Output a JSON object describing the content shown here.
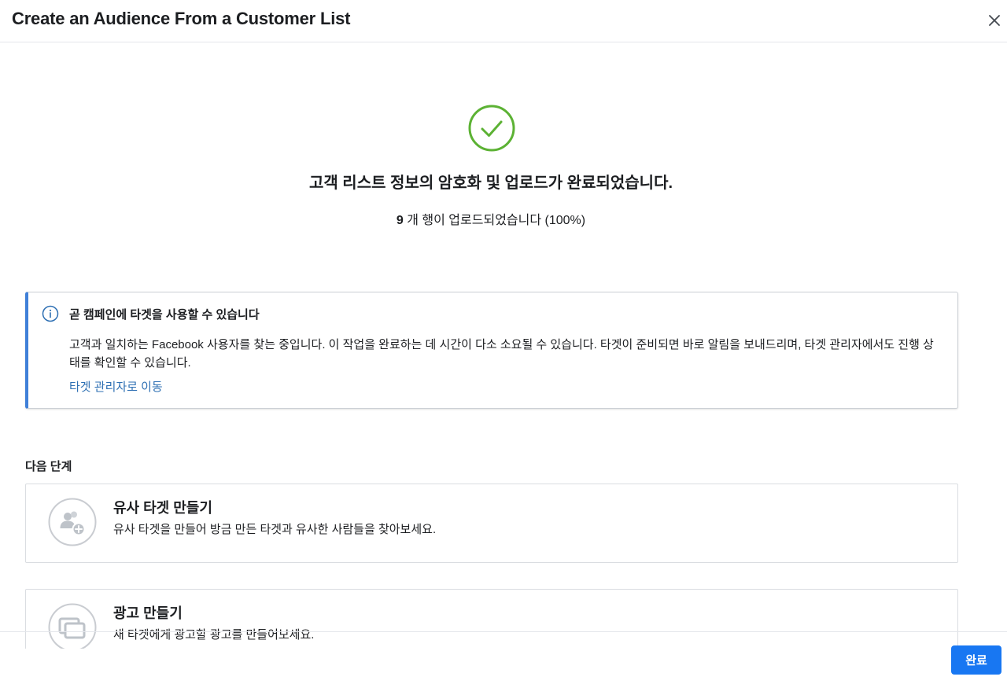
{
  "modal": {
    "title": "Create an Audience From a Customer List",
    "close_icon": "close-icon"
  },
  "success": {
    "icon": "check-circle-icon",
    "color": "#5cb234",
    "title": "고객 리스트 정보의 암호화 및 업로드가 완료되었습니다.",
    "row_count": "9",
    "status_text": " 개 행이 업로드되었습니다 (100%)"
  },
  "info": {
    "icon": "info-icon",
    "accent": "#4080d8",
    "title": "곧 캠페인에 타겟을 사용할 수 있습니다",
    "body": "고객과 일치하는 Facebook 사용자를 찾는 중입니다. 이 작업을 완료하는 데 시간이 다소 소요될 수 있습니다. 타겟이 준비되면 바로 알림을 보내드리며, 타겟 관리자에서도 진행 상태를 확인할 수 있습니다.",
    "link": "타겟 관리자로 이동"
  },
  "next_steps": {
    "heading": "다음 단계",
    "items": [
      {
        "icon": "people-add-icon",
        "title": "유사 타겟 만들기",
        "description": "유사 타겟을 만들어 방금 만든 타겟과 유사한 사람들을 찾아보세요."
      },
      {
        "icon": "ad-stack-icon",
        "title": "광고 만들기",
        "description": "새 타겟에게 광고할 광고를 만들어보세요."
      }
    ]
  },
  "footer": {
    "done_label": "완료",
    "button_color": "#1877f2"
  }
}
